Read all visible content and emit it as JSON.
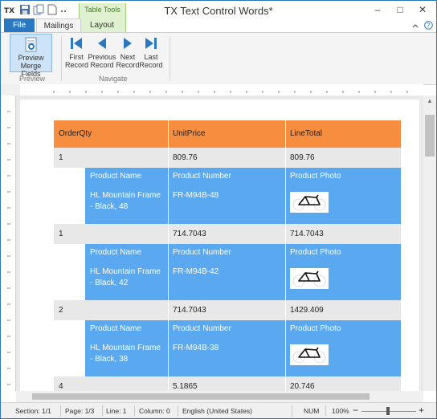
{
  "window": {
    "title": "TX Text Control Words*"
  },
  "quick_access": [
    {
      "name": "app-logo-icon"
    },
    {
      "name": "save-icon"
    },
    {
      "name": "copy-icon"
    },
    {
      "name": "new-document-icon"
    },
    {
      "name": "more-icon"
    }
  ],
  "context_tab_group": "Table Tools",
  "tabs": {
    "file": "File",
    "mailings": "Mailings",
    "layout": "Layout"
  },
  "ribbon": {
    "preview_button": [
      "Preview",
      "Merge Fields"
    ],
    "preview_group": "Preview",
    "first_record": [
      "First",
      "Record"
    ],
    "previous_record": [
      "Previous",
      "Record"
    ],
    "next_record": [
      "Next",
      "Record"
    ],
    "last_record": [
      "Last",
      "Record"
    ],
    "navigate_group": "Navigate"
  },
  "table": {
    "headers": [
      "OrderQty",
      "UnitPrice",
      "LineTotal"
    ],
    "sub_headers": [
      "Product Name",
      "Product Number",
      "Product Photo"
    ],
    "rows": [
      {
        "qty": "1",
        "price": "809.76",
        "total": "809.76",
        "product_name": "HL Mountain Frame - Black, 48",
        "product_number": "FR-M94B-48"
      },
      {
        "qty": "1",
        "price": "714.7043",
        "total": "714.7043",
        "product_name": "HL Mountain Frame - Black, 42",
        "product_number": "FR-M94B-42"
      },
      {
        "qty": "2",
        "price": "714.7043",
        "total": "1429.409",
        "product_name": "HL Mountain Frame - Black, 38",
        "product_number": "FR-M94B-38"
      },
      {
        "qty": "4",
        "price": "5.1865",
        "total": "20.746"
      }
    ]
  },
  "status": {
    "section": "Section: 1/1",
    "page": "Page: 1/3",
    "line": "Line: 1",
    "column": "Column: 0",
    "language": "English (United States)",
    "num": "NUM",
    "zoom": "100%",
    "zoom_minus": "−",
    "zoom_plus": "+"
  },
  "colors": {
    "accent": "#2b78c2",
    "header_orange": "#f78d3f",
    "sub_blue": "#5aa8f0",
    "row_gray": "#e8e8e8"
  }
}
